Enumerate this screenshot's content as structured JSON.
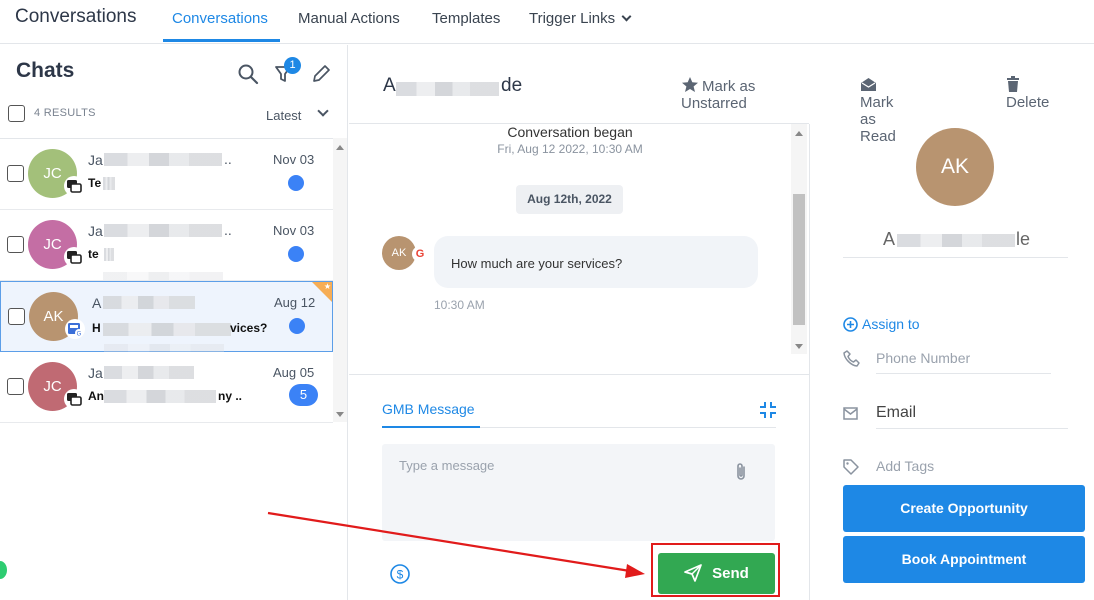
{
  "topnav": {
    "app_title": "Conversations",
    "tabs": [
      {
        "label": "Conversations",
        "active": true
      },
      {
        "label": "Manual Actions"
      },
      {
        "label": "Templates"
      },
      {
        "label": "Trigger Links"
      }
    ]
  },
  "chats": {
    "title": "Chats",
    "filter_badge": "1",
    "results": "4 RESULTS",
    "sort": "Latest",
    "rows": [
      {
        "initials": "JC",
        "color": "#a3c07a",
        "name": "Ja",
        "msg": "Te",
        "date": "Nov 03",
        "unread": ""
      },
      {
        "initials": "JC",
        "color": "#c46ea4",
        "name": "Ja",
        "msg": "te",
        "date": "Nov 03",
        "unread": ""
      },
      {
        "initials": "AK",
        "color": "#b89470",
        "name": "A",
        "msg": "H",
        "msg_tail": "vices?",
        "date": "Aug 12",
        "unread": ""
      },
      {
        "initials": "JC",
        "color": "#c06a73",
        "name": "Ja",
        "msg": "An",
        "msg_tail": "ny ..",
        "date": "Aug 05",
        "unread": "5"
      }
    ]
  },
  "conversation": {
    "contact_name": "A",
    "contact_name_tail": "de",
    "actions": {
      "unstar": "Mark as Unstarred",
      "read": "Mark as Read",
      "delete": "Delete"
    },
    "began": "Conversation began",
    "began_date": "Fri, Aug 12 2022, 10:30 AM",
    "date_pill": "Aug 12th, 2022",
    "message": {
      "avatar": "AK",
      "text": "How much are your services?",
      "time": "10:30 AM"
    }
  },
  "composer": {
    "tab": "GMB Message",
    "placeholder": "Type a message",
    "send": "Send"
  },
  "contact_panel": {
    "initials": "AK",
    "name_head": "A",
    "name_tail": "le",
    "assign": "Assign to",
    "phone": "Phone Number",
    "email": "Email",
    "tags": "Add Tags",
    "create_opportunity": "Create Opportunity",
    "book_appointment": "Book Appointment"
  },
  "colors": {
    "accent": "#1e88e5",
    "send": "#32a852",
    "annotation": "#e11b1b"
  }
}
